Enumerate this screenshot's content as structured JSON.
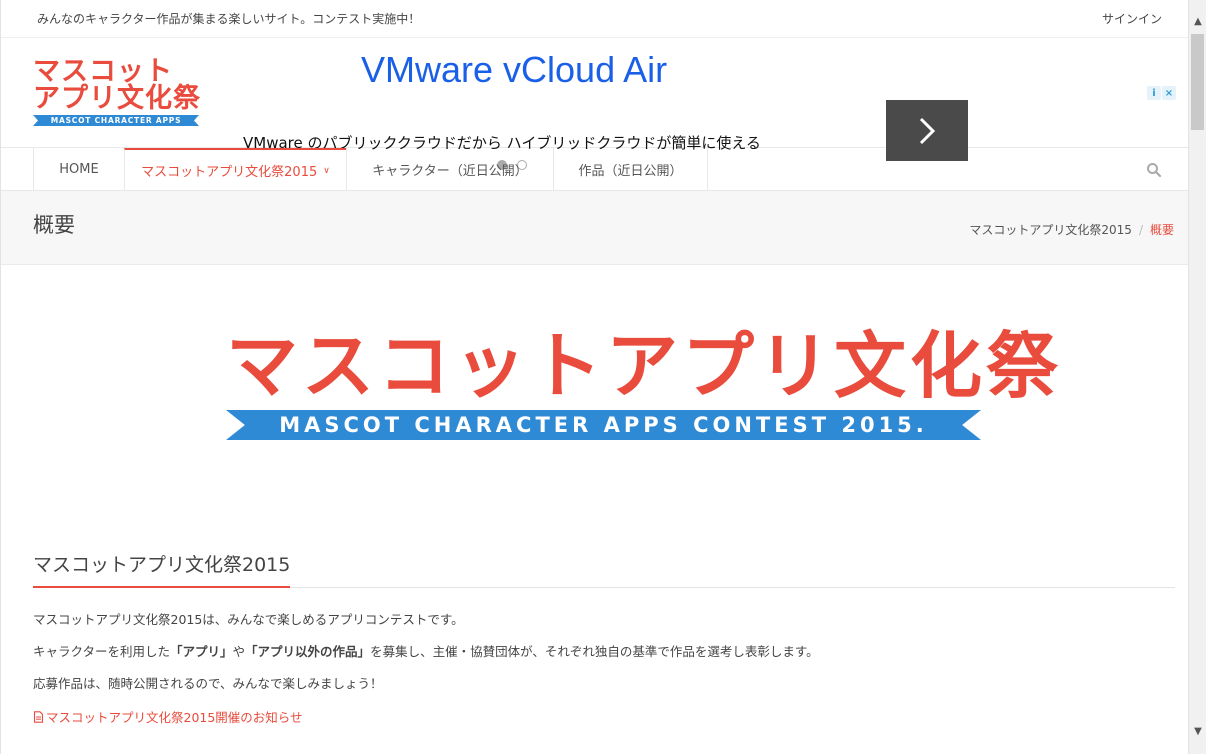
{
  "topbar": {
    "tagline": "みんなのキャラクター作品が集まる楽しいサイト。コンテスト実施中！",
    "signin": "サインイン"
  },
  "header": {
    "logo_jp_line1": "マスコット",
    "logo_jp_line2": "アプリ文化祭",
    "logo_en": "MASCOT CHARACTER APPS CONTEST"
  },
  "ad": {
    "title": "VMware vCloud Air",
    "description": "VMware のパブリッククラウドだから ハイブリッドクラウドが簡単に使える",
    "info_label": "i",
    "close_label": "×"
  },
  "nav": {
    "items": [
      {
        "label": "HOME"
      },
      {
        "label": "マスコットアプリ文化祭2015"
      },
      {
        "label": "キャラクター（近日公開）"
      },
      {
        "label": "作品（近日公開）"
      }
    ]
  },
  "page": {
    "title": "概要",
    "breadcrumb": [
      "マスコットアプリ文化祭2015",
      "概要"
    ]
  },
  "hero": {
    "jp": "マスコットアプリ文化祭",
    "en": "MASCOT CHARACTER APPS CONTEST 2015."
  },
  "content": {
    "heading": "マスコットアプリ文化祭2015",
    "p1": "マスコットアプリ文化祭2015は、みんなで楽しめるアプリコンテストです。",
    "p2_pre": "キャラクターを利用した",
    "p2_b1": "「アプリ」",
    "p2_mid": "や",
    "p2_b2": "「アプリ以外の作品」",
    "p2_post": "を募集し、主催・協賛団体が、それぞれ独自の基準で作品を選考し表彰します。",
    "p3": "応募作品は、随時公開されるので、みんなで楽しみましょう！",
    "link": "マスコットアプリ文化祭2015開催のお知らせ"
  },
  "colors": {
    "accent": "#e94b3c",
    "ribbon": "#2f8ad6",
    "ad_link": "#1a5fe8"
  }
}
